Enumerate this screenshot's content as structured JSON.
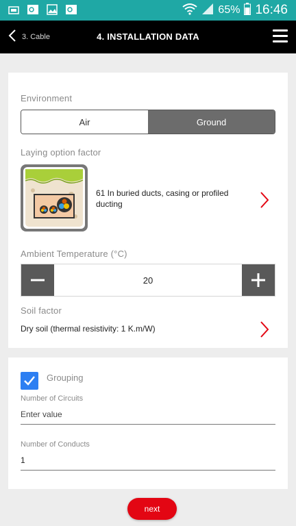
{
  "statusbar": {
    "battery": "65%",
    "time": "16:46",
    "left_icons": [
      "data-sim-icon",
      "outlook-icon",
      "image-icon",
      "outlook-icon"
    ],
    "bg_color": "#1fa8a5"
  },
  "header": {
    "back_label": "3. Cable",
    "title": "4. INSTALLATION DATA"
  },
  "environment": {
    "label": "Environment",
    "options": [
      "Air",
      "Ground"
    ],
    "selected": "Ground"
  },
  "laying": {
    "label": "Laying option factor",
    "value": "61 In buried ducts, casing or profiled ducting"
  },
  "ambient": {
    "label": "Ambient Temperature (°C)",
    "value": "20"
  },
  "soil": {
    "label": "Soil factor",
    "value": "Dry soil (thermal resistivity: 1 K.m/W)"
  },
  "grouping": {
    "label": "Grouping",
    "checked": true,
    "circuits_label": "Number of Circuits",
    "circuits_placeholder": "Enter value",
    "conducts_label": "Number of Conducts",
    "conducts_value": "1"
  },
  "footer": {
    "next_label": "next"
  },
  "colors": {
    "accent": "#e30613",
    "checkbox": "#2d7ff2",
    "stepper": "#595959",
    "segment_selected": "#6c6c6c"
  }
}
